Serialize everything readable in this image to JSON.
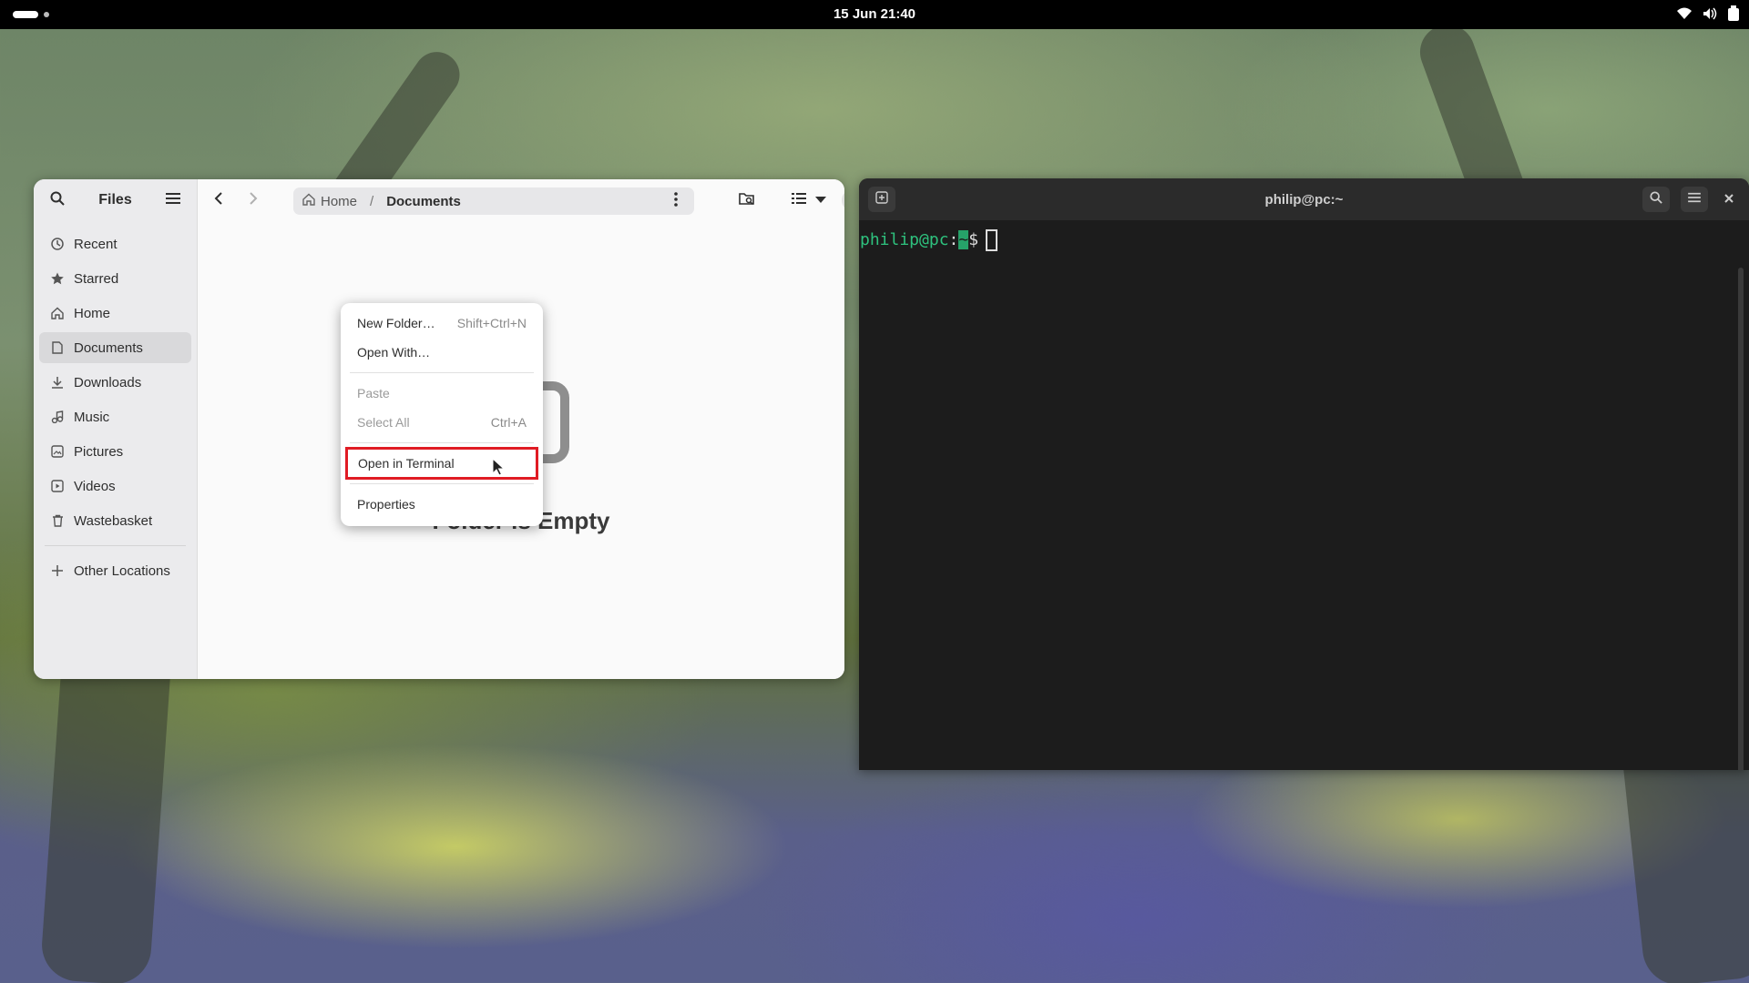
{
  "topbar": {
    "datetime": "15 Jun  21:40"
  },
  "files": {
    "sidebar_title": "Files",
    "sidebar_items": [
      {
        "label": "Recent",
        "icon": "clock-icon"
      },
      {
        "label": "Starred",
        "icon": "star-icon"
      },
      {
        "label": "Home",
        "icon": "home-icon"
      },
      {
        "label": "Documents",
        "icon": "document-icon",
        "active": true
      },
      {
        "label": "Downloads",
        "icon": "download-icon"
      },
      {
        "label": "Music",
        "icon": "music-icon"
      },
      {
        "label": "Pictures",
        "icon": "picture-icon"
      },
      {
        "label": "Videos",
        "icon": "video-icon"
      },
      {
        "label": "Wastebasket",
        "icon": "trash-icon"
      }
    ],
    "other_locations": "Other Locations",
    "path": {
      "home": "Home",
      "separator": "/",
      "current": "Documents"
    },
    "empty_text": "Folder is Empty"
  },
  "context_menu": {
    "items": [
      {
        "label": "New Folder…",
        "accel": "Shift+Ctrl+N"
      },
      {
        "label": "Open With…",
        "accel": ""
      },
      {
        "label": "Paste",
        "accel": "",
        "disabled": true
      },
      {
        "label": "Select All",
        "accel": "Ctrl+A",
        "disabled": true
      },
      {
        "label": "Open in Terminal",
        "accel": "",
        "highlighted": true
      },
      {
        "label": "Properties",
        "accel": ""
      }
    ]
  },
  "terminal": {
    "title": "philip@pc:~",
    "prompt_user": "philip@pc",
    "prompt_colon": ":",
    "prompt_path": "~",
    "prompt_symbol": "$"
  },
  "colors": {
    "highlight_outline": "#e01b24",
    "prompt_green": "#2ec27e"
  }
}
